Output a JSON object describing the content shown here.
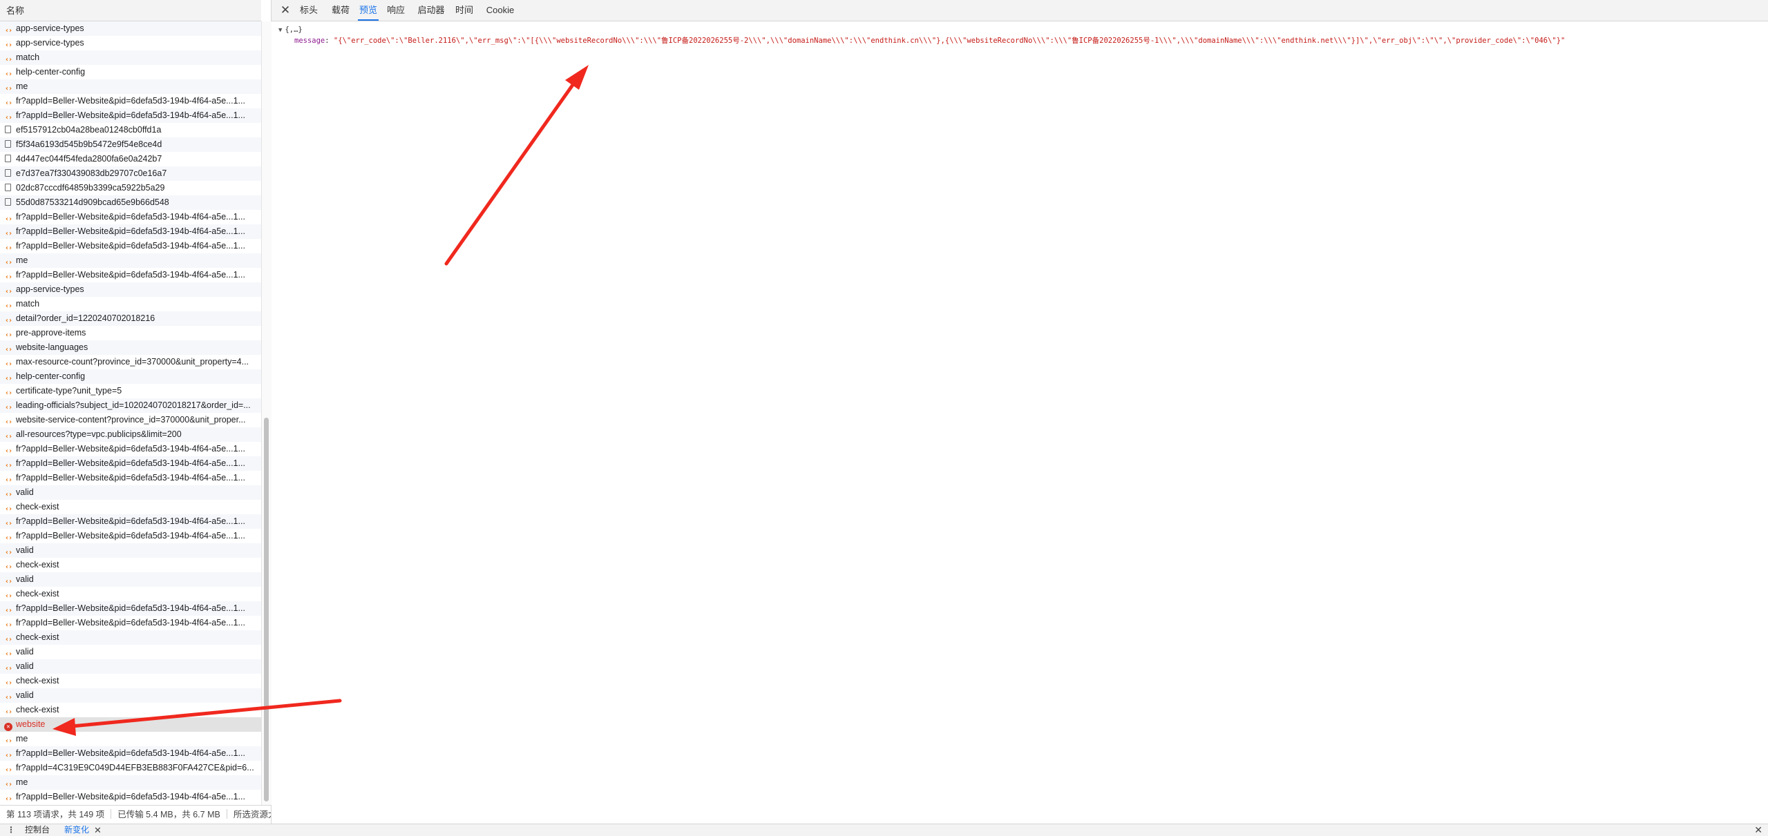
{
  "list": {
    "header": "名称",
    "rows": [
      {
        "type": "xhr",
        "name": "app-service-types"
      },
      {
        "type": "xhr",
        "name": "app-service-types"
      },
      {
        "type": "xhr",
        "name": "match"
      },
      {
        "type": "xhr",
        "name": "help-center-config"
      },
      {
        "type": "xhr",
        "name": "me"
      },
      {
        "type": "xhr",
        "name": "fr?appId=Beller-Website&pid=6defa5d3-194b-4f64-a5e...1..."
      },
      {
        "type": "xhr",
        "name": "fr?appId=Beller-Website&pid=6defa5d3-194b-4f64-a5e...1..."
      },
      {
        "type": "doc",
        "name": "ef5157912cb04a28bea01248cb0ffd1a"
      },
      {
        "type": "doc",
        "name": "f5f34a6193d545b9b5472e9f54e8ce4d"
      },
      {
        "type": "doc",
        "name": "4d447ec044f54feda2800fa6e0a242b7"
      },
      {
        "type": "doc",
        "name": "e7d37ea7f330439083db29707c0e16a7"
      },
      {
        "type": "doc",
        "name": "02dc87cccdf64859b3399ca5922b5a29"
      },
      {
        "type": "doc",
        "name": "55d0d87533214d909bcad65e9b66d548"
      },
      {
        "type": "xhr",
        "name": "fr?appId=Beller-Website&pid=6defa5d3-194b-4f64-a5e...1..."
      },
      {
        "type": "xhr",
        "name": "fr?appId=Beller-Website&pid=6defa5d3-194b-4f64-a5e...1..."
      },
      {
        "type": "xhr",
        "name": "fr?appId=Beller-Website&pid=6defa5d3-194b-4f64-a5e...1..."
      },
      {
        "type": "xhr",
        "name": "me"
      },
      {
        "type": "xhr",
        "name": "fr?appId=Beller-Website&pid=6defa5d3-194b-4f64-a5e...1..."
      },
      {
        "type": "xhr",
        "name": "app-service-types"
      },
      {
        "type": "xhr",
        "name": "match"
      },
      {
        "type": "xhr",
        "name": "detail?order_id=1220240702018216"
      },
      {
        "type": "xhr",
        "name": "pre-approve-items"
      },
      {
        "type": "xhr",
        "name": "website-languages"
      },
      {
        "type": "xhr",
        "name": "max-resource-count?province_id=370000&unit_property=4..."
      },
      {
        "type": "xhr",
        "name": "help-center-config"
      },
      {
        "type": "xhr",
        "name": "certificate-type?unit_type=5"
      },
      {
        "type": "xhr",
        "name": "leading-officials?subject_id=1020240702018217&order_id=..."
      },
      {
        "type": "xhr",
        "name": "website-service-content?province_id=370000&unit_proper..."
      },
      {
        "type": "xhr",
        "name": "all-resources?type=vpc.publicips&limit=200"
      },
      {
        "type": "xhr",
        "name": "fr?appId=Beller-Website&pid=6defa5d3-194b-4f64-a5e...1..."
      },
      {
        "type": "xhr",
        "name": "fr?appId=Beller-Website&pid=6defa5d3-194b-4f64-a5e...1..."
      },
      {
        "type": "xhr",
        "name": "fr?appId=Beller-Website&pid=6defa5d3-194b-4f64-a5e...1..."
      },
      {
        "type": "xhr",
        "name": "valid"
      },
      {
        "type": "xhr",
        "name": "check-exist"
      },
      {
        "type": "xhr",
        "name": "fr?appId=Beller-Website&pid=6defa5d3-194b-4f64-a5e...1..."
      },
      {
        "type": "xhr",
        "name": "fr?appId=Beller-Website&pid=6defa5d3-194b-4f64-a5e...1..."
      },
      {
        "type": "xhr",
        "name": "valid"
      },
      {
        "type": "xhr",
        "name": "check-exist"
      },
      {
        "type": "xhr",
        "name": "valid"
      },
      {
        "type": "xhr",
        "name": "check-exist"
      },
      {
        "type": "xhr",
        "name": "fr?appId=Beller-Website&pid=6defa5d3-194b-4f64-a5e...1..."
      },
      {
        "type": "xhr",
        "name": "fr?appId=Beller-Website&pid=6defa5d3-194b-4f64-a5e...1..."
      },
      {
        "type": "xhr",
        "name": "check-exist"
      },
      {
        "type": "xhr",
        "name": "valid"
      },
      {
        "type": "xhr",
        "name": "valid"
      },
      {
        "type": "xhr",
        "name": "check-exist"
      },
      {
        "type": "xhr",
        "name": "valid"
      },
      {
        "type": "xhr",
        "name": "check-exist"
      },
      {
        "type": "error",
        "name": "website",
        "selected": true
      },
      {
        "type": "xhr",
        "name": "me"
      },
      {
        "type": "xhr",
        "name": "fr?appId=Beller-Website&pid=6defa5d3-194b-4f64-a5e...1..."
      },
      {
        "type": "xhr",
        "name": "fr?appId=4C319E9C049D44EFB3EB883F0FA427CE&pid=6..."
      },
      {
        "type": "xhr",
        "name": "me"
      },
      {
        "type": "xhr",
        "name": "fr?appId=Beller-Website&pid=6defa5d3-194b-4f64-a5e...1..."
      }
    ],
    "icons": {
      "xhr": "xhr-icon",
      "doc": "document-icon",
      "error": "error-icon"
    },
    "scroll_position_fraction": 0.47
  },
  "status": {
    "requests": "第 113 项请求，共 149 项",
    "transferred": "已传输 5.4 MB，共 6.7 MB",
    "selected": "所选资源大"
  },
  "detail": {
    "close_icon": "close-icon",
    "tabs": [
      "标头",
      "载荷",
      "预览",
      "响应",
      "启动器",
      "时间",
      "Cookie"
    ],
    "active_tab": "预览"
  },
  "preview": {
    "root": "{,…}",
    "message_key": "message",
    "message_value": "\"{\\\"err_code\\\":\\\"Beller.2116\\\",\\\"err_msg\\\":\\\"[{\\\\\\\"websiteRecordNo\\\\\\\":\\\\\\\"鲁ICP备2022026255号-2\\\\\\\",\\\\\\\"domainName\\\\\\\":\\\\\\\"endthink.cn\\\\\\\"},{\\\\\\\"websiteRecordNo\\\\\\\":\\\\\\\"鲁ICP备2022026255号-1\\\\\\\",\\\\\\\"domainName\\\\\\\":\\\\\\\"endthink.net\\\\\\\"}]\\\",\\\"err_obj\\\":\\\"\\\",\\\"provider_code\\\":\\\"046\\\"}\""
  },
  "drawer": {
    "menu_icon": "more-vertical-icon",
    "console_tab": "控制台",
    "changes_tab": "新变化",
    "close_icon": "close-icon"
  },
  "colors": {
    "accent": "#1a73e8",
    "error": "#d93025",
    "xhr_icon": "#e8710a",
    "annotation_arrow": "#f0281e",
    "string_value": "#c41a16",
    "property_key": "#8e1c8e"
  }
}
